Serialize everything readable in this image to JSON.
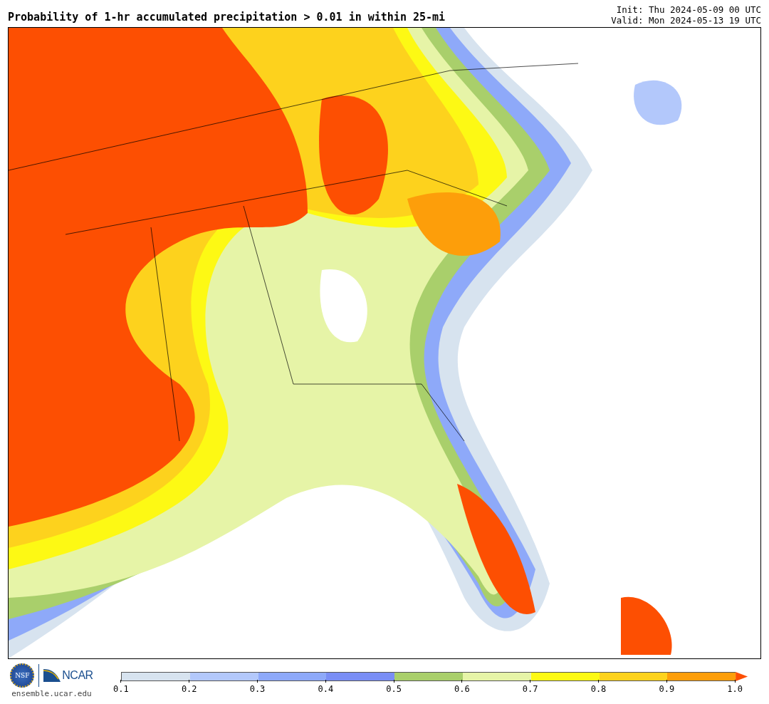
{
  "title": "Probability of 1-hr accumulated precipitation > 0.01 in within 25-mi",
  "init": "Init: Thu 2024-05-09 00 UTC",
  "valid": "Valid: Mon 2024-05-13 19 UTC",
  "logos": {
    "nsf": "NSF",
    "ncar": "NCAR",
    "site": "ensemble.ucar.edu"
  },
  "colorbar": {
    "bins": [
      {
        "color": "#d7e3ef"
      },
      {
        "color": "#b3c8fb"
      },
      {
        "color": "#8ea9f9"
      },
      {
        "color": "#7a8ef5"
      },
      {
        "color": "#a9cf6b"
      },
      {
        "color": "#e6f4a7"
      },
      {
        "color": "#fdf914"
      },
      {
        "color": "#fdd21d"
      },
      {
        "color": "#fd9e0a"
      }
    ],
    "extend": {
      "color": "#fd4f02"
    },
    "ticks": [
      "0.1",
      "0.2",
      "0.3",
      "0.4",
      "0.5",
      "0.6",
      "0.7",
      "0.8",
      "0.9",
      "1.0"
    ]
  }
}
